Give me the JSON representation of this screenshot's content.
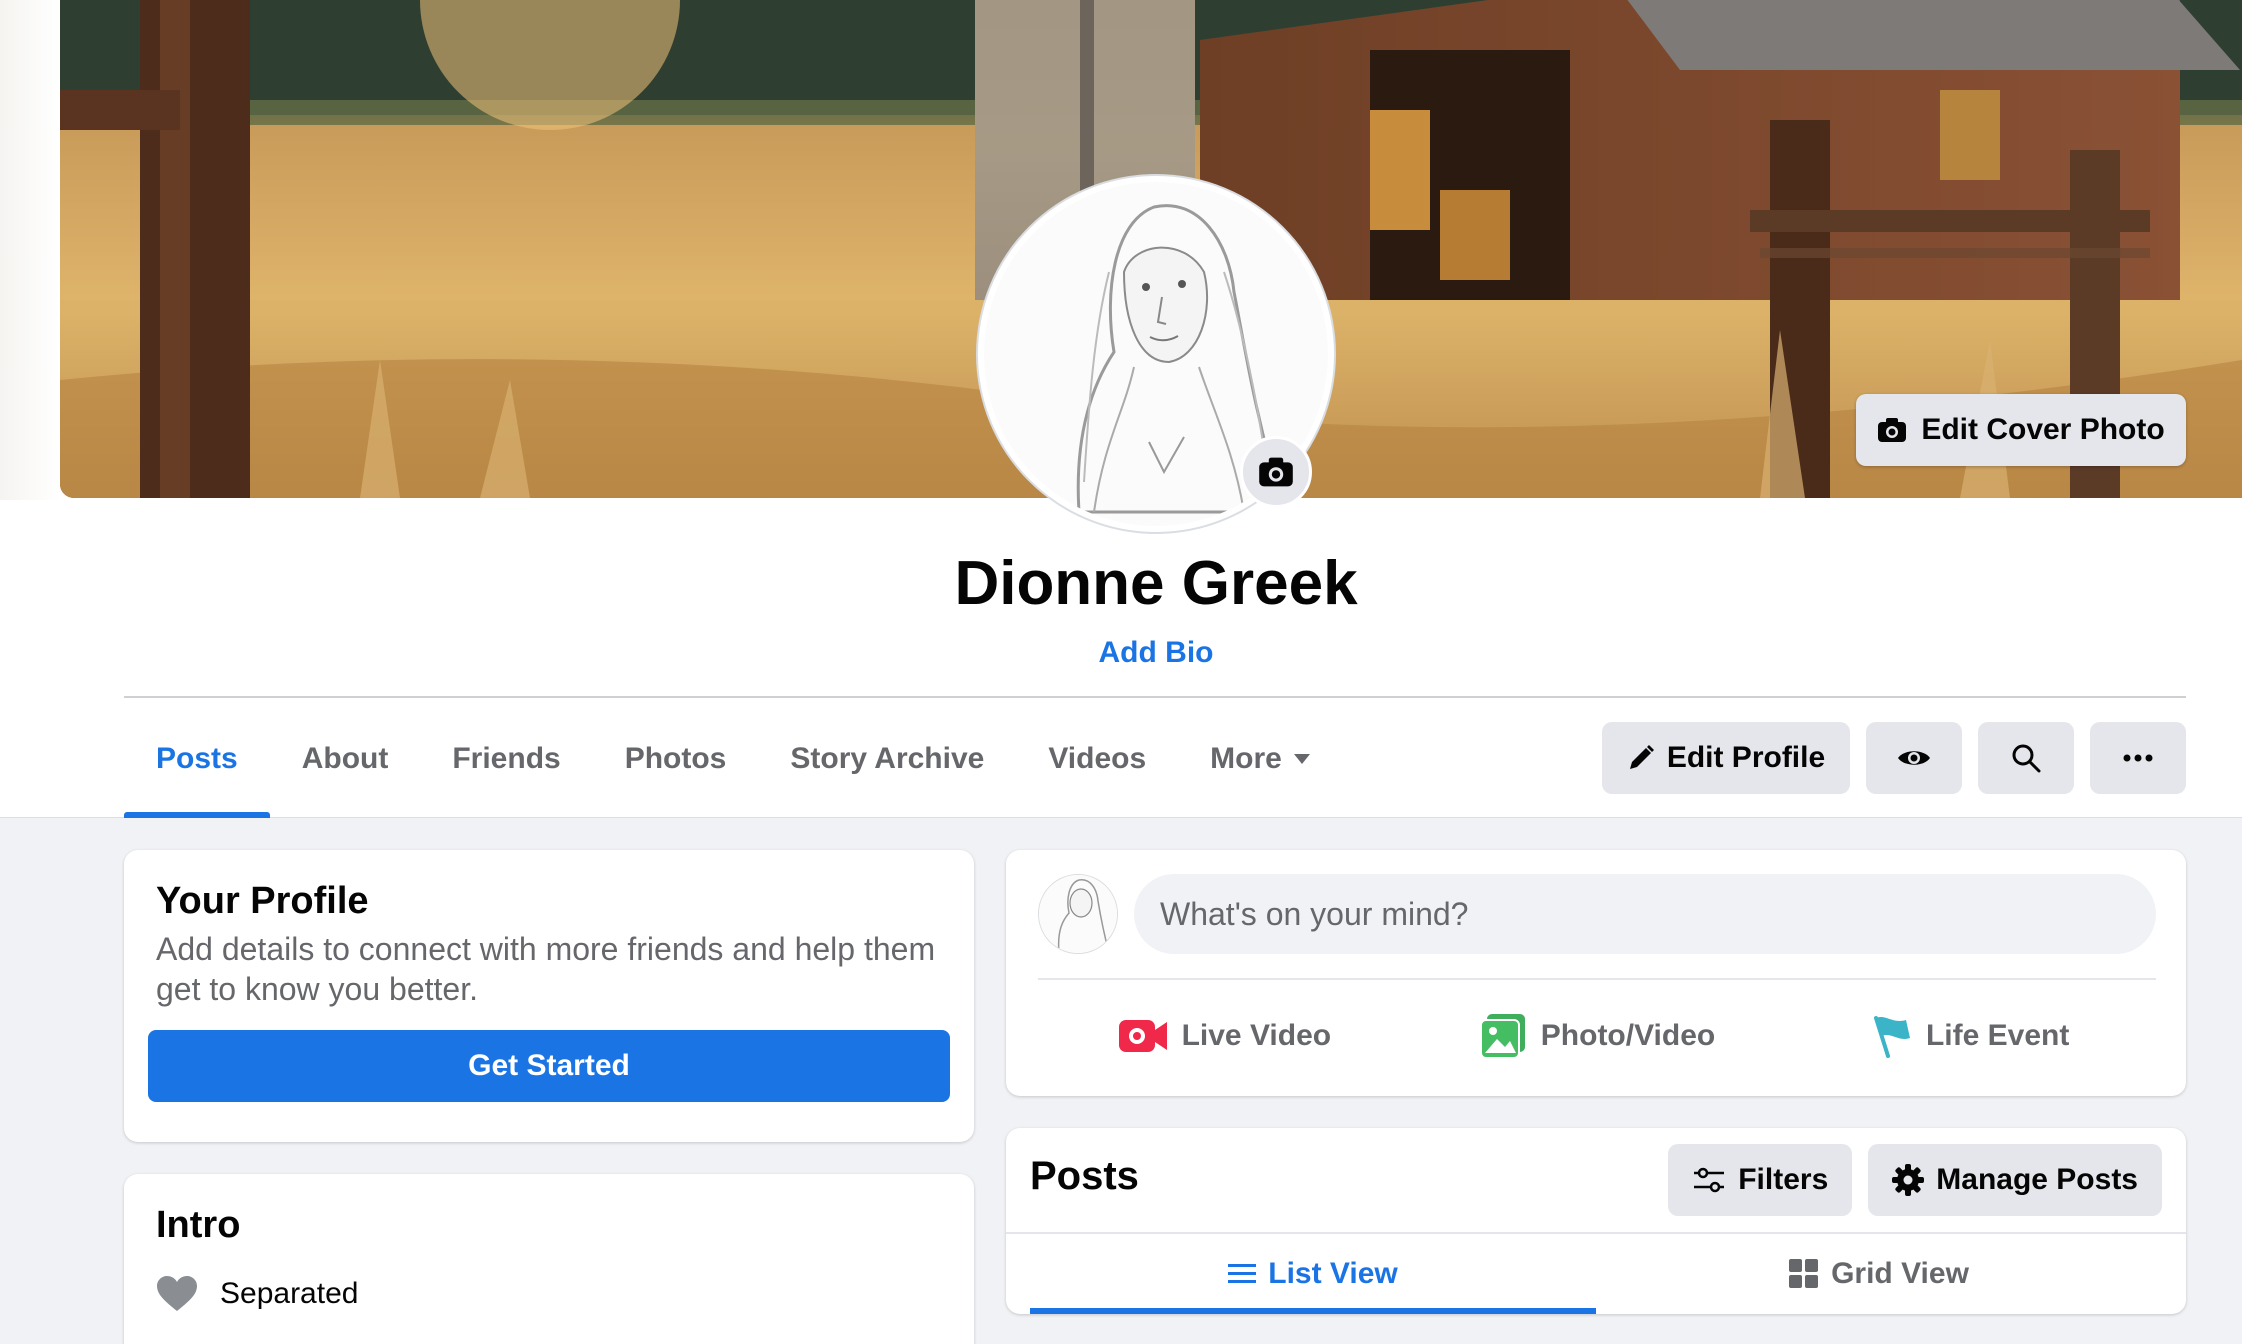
{
  "profile": {
    "name": "Dionne Greek",
    "add_bio": "Add Bio",
    "edit_cover_photo": "Edit Cover Photo"
  },
  "nav": {
    "tabs": [
      {
        "label": "Posts",
        "active": true
      },
      {
        "label": "About"
      },
      {
        "label": "Friends"
      },
      {
        "label": "Photos"
      },
      {
        "label": "Story Archive"
      },
      {
        "label": "Videos"
      },
      {
        "label": "More"
      }
    ],
    "edit_profile": "Edit Profile"
  },
  "your_profile": {
    "title": "Your Profile",
    "text": "Add details to connect with more friends and help them get to know you better.",
    "button": "Get Started"
  },
  "intro": {
    "title": "Intro",
    "relationship": "Separated"
  },
  "composer": {
    "placeholder": "What's on your mind?",
    "actions": [
      {
        "label": "Live Video",
        "icon": "live-video-icon"
      },
      {
        "label": "Photo/Video",
        "icon": "photo-icon"
      },
      {
        "label": "Life Event",
        "icon": "flag-icon"
      }
    ]
  },
  "posts": {
    "title": "Posts",
    "filters": "Filters",
    "manage": "Manage Posts",
    "views": [
      {
        "label": "List View",
        "active": true
      },
      {
        "label": "Grid View"
      }
    ]
  },
  "colors": {
    "accent": "#1b74e4",
    "background": "#f0f2f5",
    "button_gray": "#e4e6eb"
  }
}
